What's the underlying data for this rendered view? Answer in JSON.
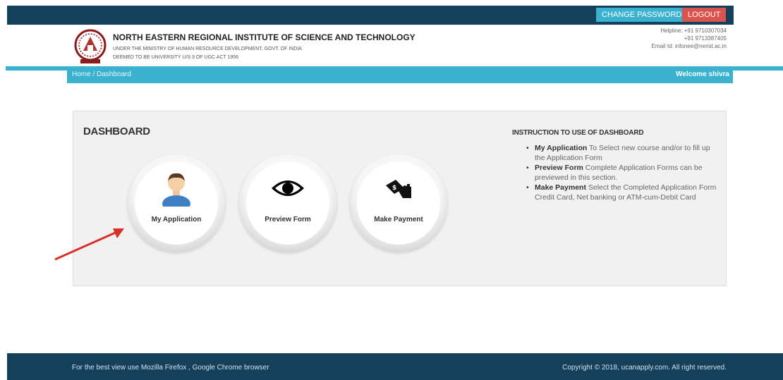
{
  "topbar": {
    "change_password_label": "CHANGE PASSWORD",
    "logout_label": "LOGOUT"
  },
  "header": {
    "institute_name": "NORTH EASTERN REGIONAL INSTITUTE OF SCIENCE AND TECHNOLOGY",
    "subtitle_line1": "UNDER THE MINISTRY OF HUMAN RESOURCE DEVELOPMENT, GOVT. OF INDIA",
    "subtitle_line2": "DEEMED TO BE UNIVERSITY U/S 3 OF UGC ACT 1956",
    "helpline_1": "Helpline: +91 9710307034",
    "helpline_2": "+91 9713387405",
    "email": "Email Id: infonee@nerist.ac.in"
  },
  "nav": {
    "breadcrumb": "Home  /  Dashboard",
    "welcome": "Welcome shivra"
  },
  "dashboard": {
    "title": "DASHBOARD",
    "tiles": [
      {
        "label": "My Application",
        "icon": "user-icon"
      },
      {
        "label": "Preview Form",
        "icon": "eye-icon"
      },
      {
        "label": "Make Payment",
        "icon": "payment-icon"
      }
    ]
  },
  "instructions": {
    "title": "INSTRUCTION TO USE OF DASHBOARD",
    "items": [
      {
        "term": "My Application",
        "text": " To Select new course and/or to fill up the Application Form"
      },
      {
        "term": "Preview Form",
        "text": " Complete Application Forms can be previewed in this section."
      },
      {
        "term": "Make Payment",
        "text": " Select the Completed Application Form Credit Card, Net banking or ATM-cum-Debit Card"
      }
    ]
  },
  "footer": {
    "left": "For the best view use Mozilla Firefox , Google Chrome browser",
    "right": "Copyright © 2018, ucanapply.com. All right reserved."
  },
  "colors": {
    "topbar": "#15405c",
    "nav": "#3ab2cf",
    "logout": "#d9534f",
    "arrow": "#d9302a"
  }
}
